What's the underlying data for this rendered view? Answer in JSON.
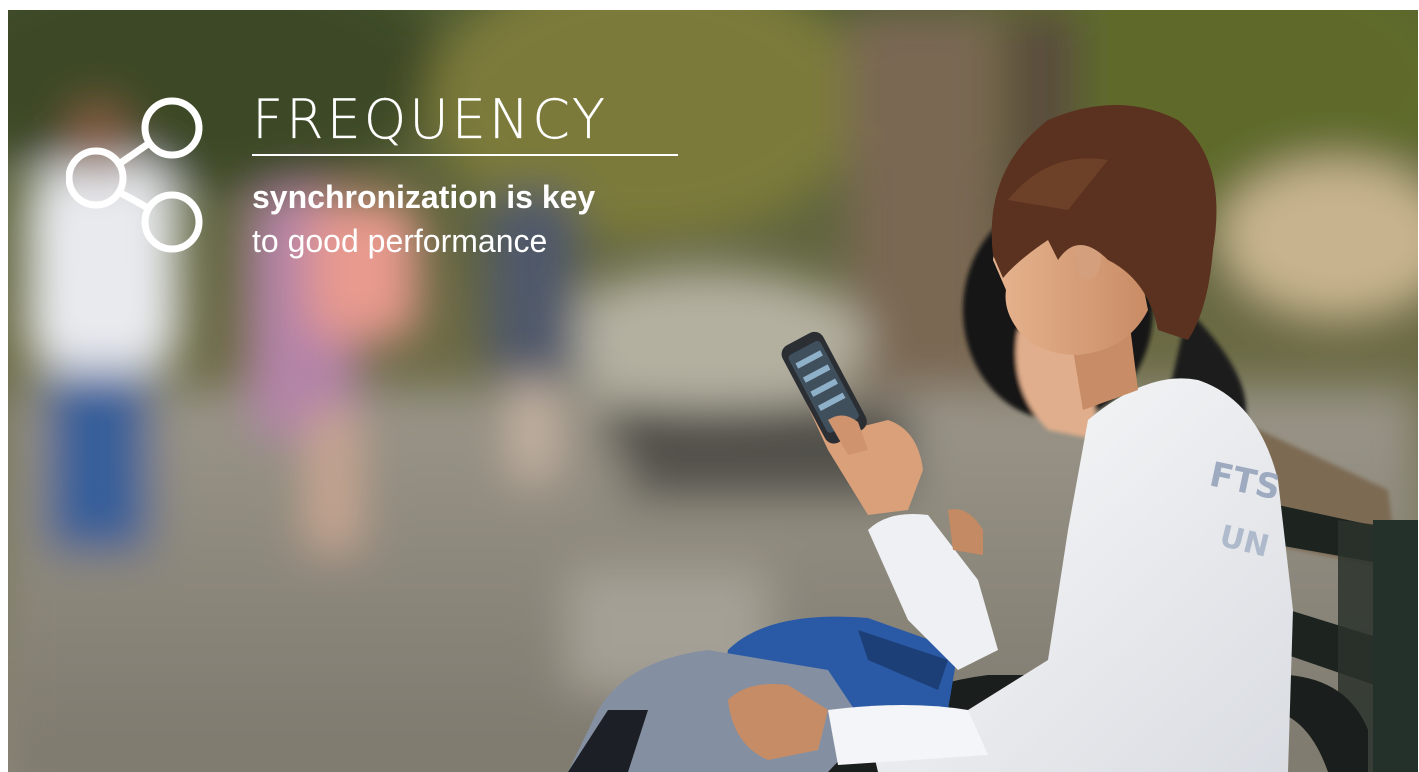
{
  "banner": {
    "title": "FREQUENCY",
    "tagline_line1": "synchronization is key",
    "tagline_line2": "to good performance",
    "icon": "share-nodes-icon",
    "text_color": "#ffffff"
  },
  "photo": {
    "subject": "young man on a park bench using a smartphone"
  }
}
